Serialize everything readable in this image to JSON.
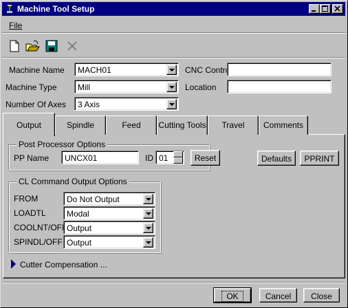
{
  "window": {
    "title": "Machine Tool Setup",
    "buttons": [
      "minimize",
      "maximize",
      "close"
    ]
  },
  "menu": {
    "file": "File"
  },
  "toolbar": {
    "icons": [
      "new-document-icon",
      "open-folder-icon",
      "save-disk-icon",
      "delete-x-icon"
    ]
  },
  "form": {
    "machine_name_label": "Machine Name",
    "machine_name_value": "MACH01",
    "machine_type_label": "Machine Type",
    "machine_type_value": "Mill",
    "axes_label": "Number Of Axes",
    "axes_value": "3 Axis",
    "cnc_control_label": "CNC Control",
    "cnc_control_value": "",
    "location_label": "Location",
    "location_value": ""
  },
  "tabs": [
    {
      "label": "Output",
      "active": true
    },
    {
      "label": "Spindle"
    },
    {
      "label": "Feed"
    },
    {
      "label": "Cutting Tools"
    },
    {
      "label": "Travel"
    },
    {
      "label": "Comments"
    }
  ],
  "post_processor": {
    "title": "Post Processor Options",
    "pp_name_label": "PP Name",
    "pp_name_value": "UNCX01",
    "id_label": "ID",
    "id_value": "01",
    "reset_label": "Reset"
  },
  "side_buttons": {
    "defaults": "Defaults",
    "pprint": "PPRINT"
  },
  "cl_options": {
    "title": "CL Command Output Options",
    "rows": [
      {
        "label": "FROM",
        "value": "Do Not Output"
      },
      {
        "label": "LOADTL",
        "value": "Modal"
      },
      {
        "label": "COOLNT/OFF",
        "value": "Output"
      },
      {
        "label": "SPINDL/OFF",
        "value": "Output"
      }
    ]
  },
  "cutter_comp": "Cutter Compensation ...",
  "footer": {
    "ok": "OK",
    "cancel": "Cancel",
    "close": "Close"
  }
}
